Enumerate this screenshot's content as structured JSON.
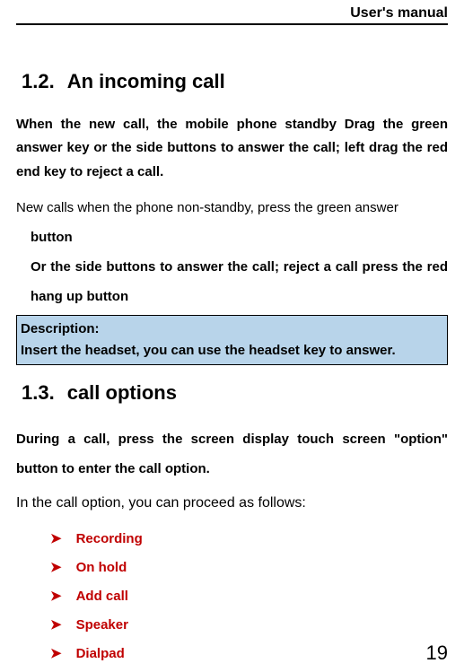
{
  "header": "User's manual",
  "section12": {
    "num": "1.2.",
    "title": "An  incoming  call"
  },
  "para1": "When the  new  call, the mobile phone standby Drag  the green answer  key or the  side  buttons to  answer  the  call; left drag the red end  key to reject  a  call.",
  "para2_normal": "New calls when the phone non-standby, press  the  green answer",
  "para2_bold1": "button",
  "para2_bold2": "Or  the  side  buttons  to  answer  the  call;  reject  a  call  press  the  red  hang  up  button",
  "desc": {
    "line1": "Description:",
    "line2": "Insert the headset,  you  can  use the headset key  to  answer."
  },
  "section13": {
    "num": "1.3.",
    "title": "call options"
  },
  "para3": "During  a  call,  press  the  screen  display  touch  screen  \"option\"  button  to  enter  the  call  option.",
  "para4": "In the call option,  you  can proceed  as  follows:",
  "list": {
    "item1": " Recording",
    "item2": "On  hold",
    "item3": "Add  call",
    "item4": "Speaker",
    "item5": "Dialpad"
  },
  "pageNumber": "19",
  "chevron": "➤"
}
